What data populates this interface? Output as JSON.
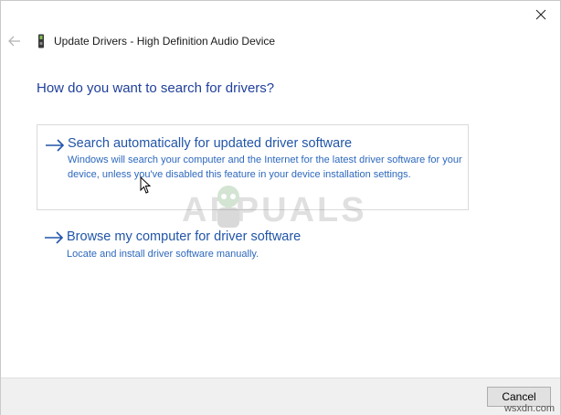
{
  "window": {
    "title": "Update Drivers - High Definition Audio Device",
    "close_icon": "close-icon",
    "back_icon": "back-arrow-icon",
    "device_icon": "audio-device-icon"
  },
  "heading": "How do you want to search for drivers?",
  "options": [
    {
      "title": "Search automatically for updated driver software",
      "description": "Windows will search your computer and the Internet for the latest driver software for your device, unless you've disabled this feature in your device installation settings.",
      "icon": "arrow-right-icon"
    },
    {
      "title": "Browse my computer for driver software",
      "description": "Locate and install driver software manually.",
      "icon": "arrow-right-icon"
    }
  ],
  "footer": {
    "cancel_label": "Cancel"
  },
  "watermark": {
    "text": "APPUALS",
    "site": "wsxdn.com"
  },
  "colors": {
    "heading": "#1f3f9a",
    "link": "#2155a8",
    "description": "#2d68bd",
    "footer_bg": "#f0f0f0"
  }
}
